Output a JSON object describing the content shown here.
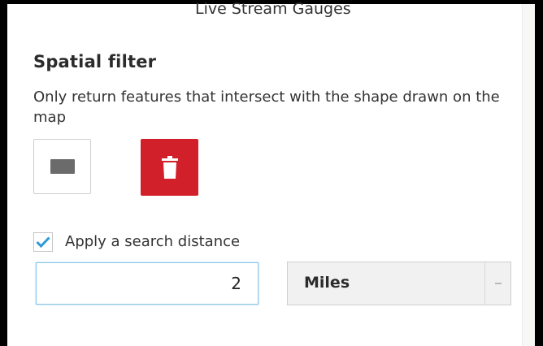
{
  "panel": {
    "title": "Live Stream Gauges"
  },
  "spatial_filter": {
    "heading": "Spatial filter",
    "description": "Only return features that intersect with the shape drawn on the map",
    "draw_tool_icon": "rectangle-icon",
    "clear_tool_icon": "trash-icon",
    "clear_color": "#d1202a"
  },
  "search_distance": {
    "checkbox_label": "Apply a search distance",
    "checked": true,
    "value": "2",
    "unit": "Miles",
    "accent_color": "#2f9ad8"
  }
}
